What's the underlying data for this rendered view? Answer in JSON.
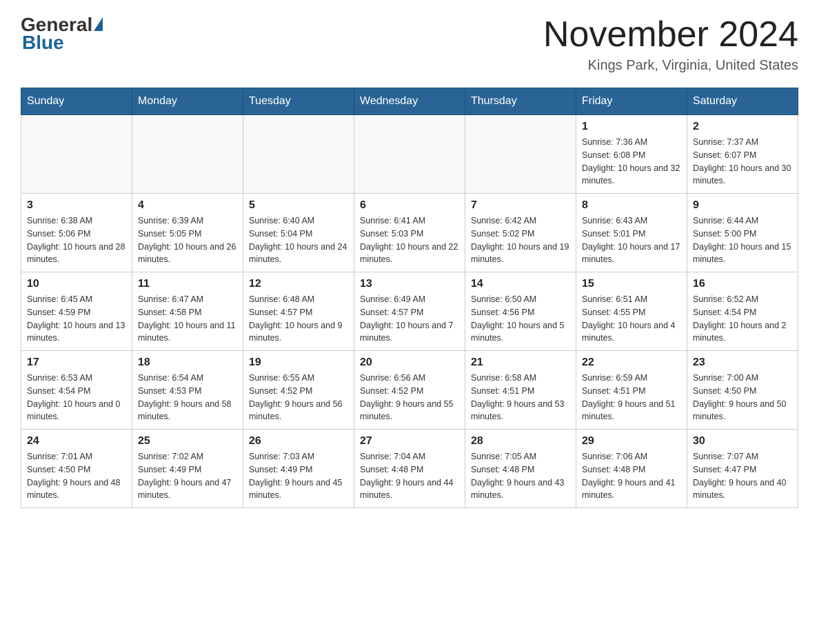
{
  "header": {
    "logo_general": "General",
    "logo_blue": "Blue",
    "month_title": "November 2024",
    "location": "Kings Park, Virginia, United States"
  },
  "days_of_week": [
    "Sunday",
    "Monday",
    "Tuesday",
    "Wednesday",
    "Thursday",
    "Friday",
    "Saturday"
  ],
  "weeks": [
    [
      {
        "day": "",
        "sunrise": "",
        "sunset": "",
        "daylight": ""
      },
      {
        "day": "",
        "sunrise": "",
        "sunset": "",
        "daylight": ""
      },
      {
        "day": "",
        "sunrise": "",
        "sunset": "",
        "daylight": ""
      },
      {
        "day": "",
        "sunrise": "",
        "sunset": "",
        "daylight": ""
      },
      {
        "day": "",
        "sunrise": "",
        "sunset": "",
        "daylight": ""
      },
      {
        "day": "1",
        "sunrise": "Sunrise: 7:36 AM",
        "sunset": "Sunset: 6:08 PM",
        "daylight": "Daylight: 10 hours and 32 minutes."
      },
      {
        "day": "2",
        "sunrise": "Sunrise: 7:37 AM",
        "sunset": "Sunset: 6:07 PM",
        "daylight": "Daylight: 10 hours and 30 minutes."
      }
    ],
    [
      {
        "day": "3",
        "sunrise": "Sunrise: 6:38 AM",
        "sunset": "Sunset: 5:06 PM",
        "daylight": "Daylight: 10 hours and 28 minutes."
      },
      {
        "day": "4",
        "sunrise": "Sunrise: 6:39 AM",
        "sunset": "Sunset: 5:05 PM",
        "daylight": "Daylight: 10 hours and 26 minutes."
      },
      {
        "day": "5",
        "sunrise": "Sunrise: 6:40 AM",
        "sunset": "Sunset: 5:04 PM",
        "daylight": "Daylight: 10 hours and 24 minutes."
      },
      {
        "day": "6",
        "sunrise": "Sunrise: 6:41 AM",
        "sunset": "Sunset: 5:03 PM",
        "daylight": "Daylight: 10 hours and 22 minutes."
      },
      {
        "day": "7",
        "sunrise": "Sunrise: 6:42 AM",
        "sunset": "Sunset: 5:02 PM",
        "daylight": "Daylight: 10 hours and 19 minutes."
      },
      {
        "day": "8",
        "sunrise": "Sunrise: 6:43 AM",
        "sunset": "Sunset: 5:01 PM",
        "daylight": "Daylight: 10 hours and 17 minutes."
      },
      {
        "day": "9",
        "sunrise": "Sunrise: 6:44 AM",
        "sunset": "Sunset: 5:00 PM",
        "daylight": "Daylight: 10 hours and 15 minutes."
      }
    ],
    [
      {
        "day": "10",
        "sunrise": "Sunrise: 6:45 AM",
        "sunset": "Sunset: 4:59 PM",
        "daylight": "Daylight: 10 hours and 13 minutes."
      },
      {
        "day": "11",
        "sunrise": "Sunrise: 6:47 AM",
        "sunset": "Sunset: 4:58 PM",
        "daylight": "Daylight: 10 hours and 11 minutes."
      },
      {
        "day": "12",
        "sunrise": "Sunrise: 6:48 AM",
        "sunset": "Sunset: 4:57 PM",
        "daylight": "Daylight: 10 hours and 9 minutes."
      },
      {
        "day": "13",
        "sunrise": "Sunrise: 6:49 AM",
        "sunset": "Sunset: 4:57 PM",
        "daylight": "Daylight: 10 hours and 7 minutes."
      },
      {
        "day": "14",
        "sunrise": "Sunrise: 6:50 AM",
        "sunset": "Sunset: 4:56 PM",
        "daylight": "Daylight: 10 hours and 5 minutes."
      },
      {
        "day": "15",
        "sunrise": "Sunrise: 6:51 AM",
        "sunset": "Sunset: 4:55 PM",
        "daylight": "Daylight: 10 hours and 4 minutes."
      },
      {
        "day": "16",
        "sunrise": "Sunrise: 6:52 AM",
        "sunset": "Sunset: 4:54 PM",
        "daylight": "Daylight: 10 hours and 2 minutes."
      }
    ],
    [
      {
        "day": "17",
        "sunrise": "Sunrise: 6:53 AM",
        "sunset": "Sunset: 4:54 PM",
        "daylight": "Daylight: 10 hours and 0 minutes."
      },
      {
        "day": "18",
        "sunrise": "Sunrise: 6:54 AM",
        "sunset": "Sunset: 4:53 PM",
        "daylight": "Daylight: 9 hours and 58 minutes."
      },
      {
        "day": "19",
        "sunrise": "Sunrise: 6:55 AM",
        "sunset": "Sunset: 4:52 PM",
        "daylight": "Daylight: 9 hours and 56 minutes."
      },
      {
        "day": "20",
        "sunrise": "Sunrise: 6:56 AM",
        "sunset": "Sunset: 4:52 PM",
        "daylight": "Daylight: 9 hours and 55 minutes."
      },
      {
        "day": "21",
        "sunrise": "Sunrise: 6:58 AM",
        "sunset": "Sunset: 4:51 PM",
        "daylight": "Daylight: 9 hours and 53 minutes."
      },
      {
        "day": "22",
        "sunrise": "Sunrise: 6:59 AM",
        "sunset": "Sunset: 4:51 PM",
        "daylight": "Daylight: 9 hours and 51 minutes."
      },
      {
        "day": "23",
        "sunrise": "Sunrise: 7:00 AM",
        "sunset": "Sunset: 4:50 PM",
        "daylight": "Daylight: 9 hours and 50 minutes."
      }
    ],
    [
      {
        "day": "24",
        "sunrise": "Sunrise: 7:01 AM",
        "sunset": "Sunset: 4:50 PM",
        "daylight": "Daylight: 9 hours and 48 minutes."
      },
      {
        "day": "25",
        "sunrise": "Sunrise: 7:02 AM",
        "sunset": "Sunset: 4:49 PM",
        "daylight": "Daylight: 9 hours and 47 minutes."
      },
      {
        "day": "26",
        "sunrise": "Sunrise: 7:03 AM",
        "sunset": "Sunset: 4:49 PM",
        "daylight": "Daylight: 9 hours and 45 minutes."
      },
      {
        "day": "27",
        "sunrise": "Sunrise: 7:04 AM",
        "sunset": "Sunset: 4:48 PM",
        "daylight": "Daylight: 9 hours and 44 minutes."
      },
      {
        "day": "28",
        "sunrise": "Sunrise: 7:05 AM",
        "sunset": "Sunset: 4:48 PM",
        "daylight": "Daylight: 9 hours and 43 minutes."
      },
      {
        "day": "29",
        "sunrise": "Sunrise: 7:06 AM",
        "sunset": "Sunset: 4:48 PM",
        "daylight": "Daylight: 9 hours and 41 minutes."
      },
      {
        "day": "30",
        "sunrise": "Sunrise: 7:07 AM",
        "sunset": "Sunset: 4:47 PM",
        "daylight": "Daylight: 9 hours and 40 minutes."
      }
    ]
  ]
}
